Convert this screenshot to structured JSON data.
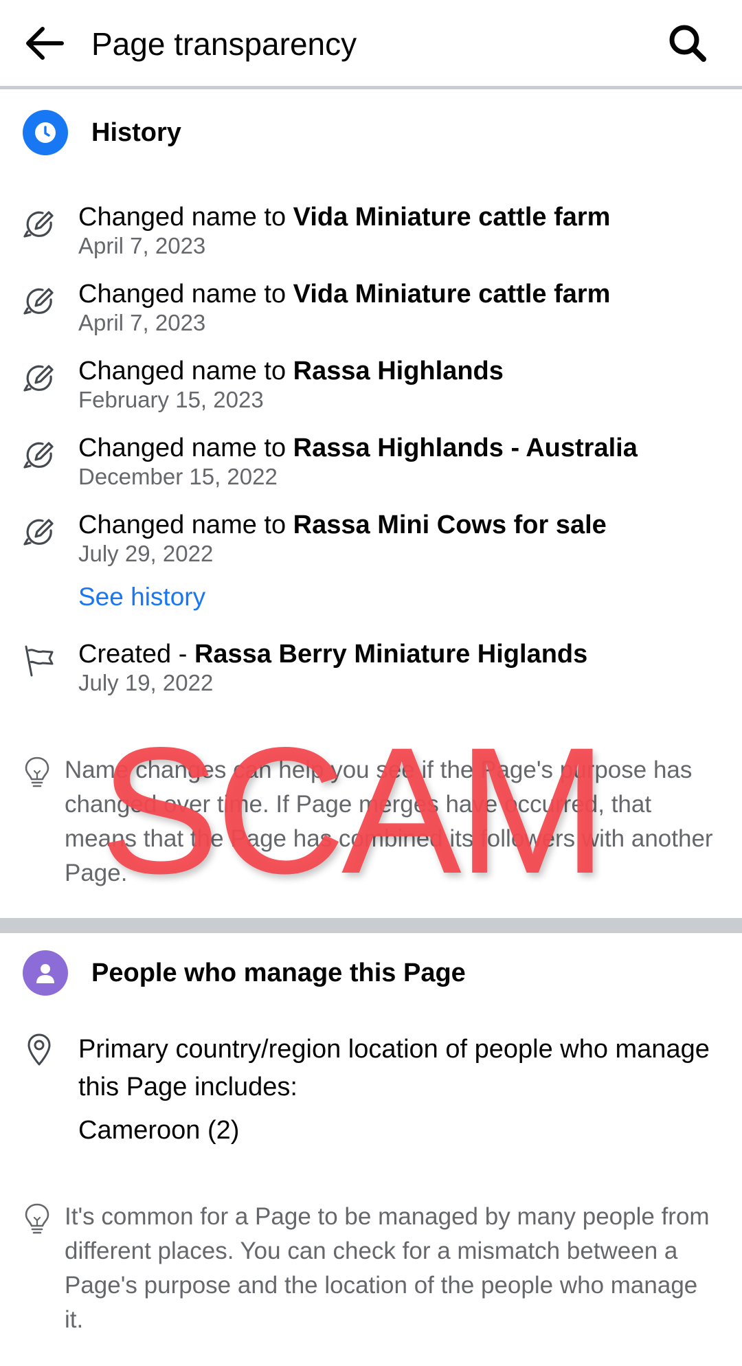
{
  "header": {
    "title": "Page transparency",
    "back_icon": "arrow-left-icon",
    "search_icon": "search-icon"
  },
  "history": {
    "title": "History",
    "icon": "clock-icon",
    "icon_color": "#1877f2",
    "items": [
      {
        "prefix": "Changed name to ",
        "name": "Vida Miniature cattle farm",
        "date": "April 7, 2023",
        "icon": "edit-name-icon"
      },
      {
        "prefix": "Changed name to ",
        "name": "Vida Miniature cattle farm",
        "date": "April 7, 2023",
        "icon": "edit-name-icon"
      },
      {
        "prefix": "Changed name to ",
        "name": "Rassa Highlands",
        "date": "February 15, 2023",
        "icon": "edit-name-icon"
      },
      {
        "prefix": "Changed name to ",
        "name": "Rassa Highlands - Australia",
        "date": "December 15, 2022",
        "icon": "edit-name-icon"
      },
      {
        "prefix": "Changed name to ",
        "name": "Rassa Mini Cows for sale",
        "date": "July 29, 2022",
        "icon": "edit-name-icon"
      }
    ],
    "see_history": "See history",
    "created": {
      "prefix": "Created - ",
      "name": "Rassa Berry Miniature Higlands",
      "date": "July 19, 2022",
      "icon": "flag-icon"
    },
    "tip": "Name changes can help you see if the Page's purpose has changed over time. If Page merges have occurred, that means that the Page has combined its followers with another Page."
  },
  "managers": {
    "title": "People who manage this Page",
    "icon": "person-icon",
    "icon_color": "#8c6cd6",
    "location_text": "Primary country/region location of people who manage this Page includes:",
    "location_value": "Cameroon (2)",
    "location_icon": "map-pin-icon",
    "tip": "It's common for a Page to be managed by many people from different places. You can check for a mismatch between a Page's purpose and the location of the people who manage it."
  },
  "overlay": {
    "stamp_text": "SCAM",
    "stamp_color": "#f44850"
  }
}
